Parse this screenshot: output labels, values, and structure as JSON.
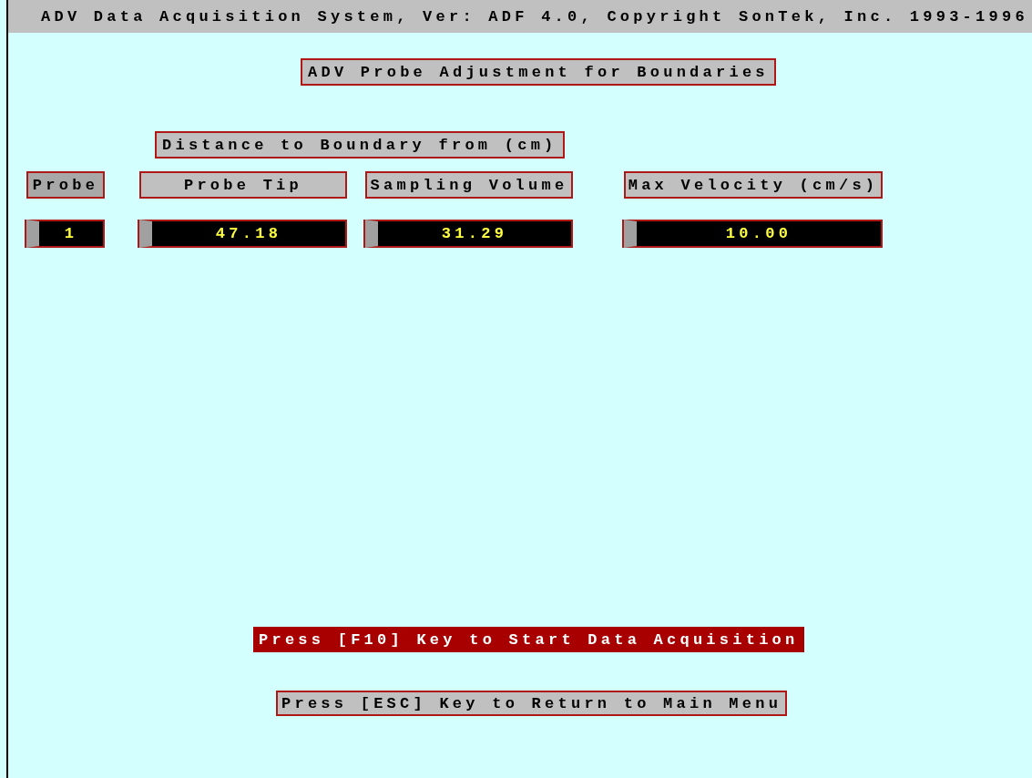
{
  "window": {
    "title": "ADV Data Acquisition System, Ver: ADF 4.0, Copyright SonTek, Inc. 1993-1996"
  },
  "heading": "ADV Probe Adjustment for Boundaries",
  "group_label": "Distance to Boundary from (cm)",
  "columns": [
    {
      "label": "Probe",
      "selected": true,
      "value": "1"
    },
    {
      "label": "Probe Tip",
      "selected": false,
      "value": "47.18"
    },
    {
      "label": "Sampling Volume",
      "selected": false,
      "value": "31.29"
    },
    {
      "label": "Max Velocity (cm/s)",
      "selected": false,
      "value": "10.00"
    }
  ],
  "prompts": [
    {
      "text": "Press [F10] Key to Start Data Acquisition",
      "kind": "highlight"
    },
    {
      "text": "Press [ESC] Key to Return to Main Menu",
      "kind": "plain"
    }
  ]
}
